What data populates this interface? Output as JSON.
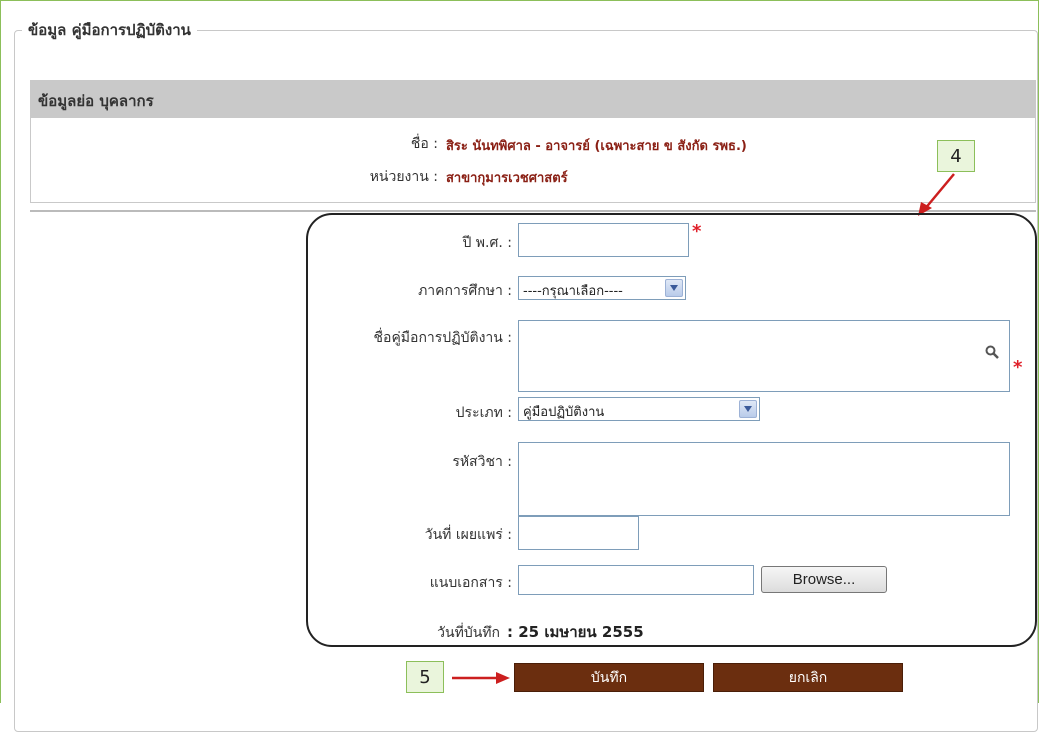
{
  "fieldset": {
    "legend": "ข้อมูล คู่มือการปฏิบัติงาน"
  },
  "personnel": {
    "header": "ข้อมูลย่อ บุคลากร",
    "name_label": "ชื่อ :",
    "name_value": "สิระ นันทพิศาล -  อาจารย์ (เฉพาะสาย ข สังกัด รพธ.)",
    "unit_label": "หน่วยงาน :",
    "unit_value": "สาขากุมารเวชศาสตร์"
  },
  "form": {
    "year_label": "ปี พ.ศ. :",
    "year_value": "",
    "semester_label": "ภาคการศึกษา :",
    "semester_selected": "----กรุณาเลือก----",
    "manual_name_label": "ชื่อคู่มือการปฏิบัติงาน :",
    "manual_name_value": "",
    "type_label": "ประเภท :",
    "type_selected": "คู่มือปฏิบัติงาน",
    "course_code_label": "รหัสวิชา :",
    "course_code_value": "",
    "publish_date_label": "วันที่ เผยแพร่ :",
    "publish_date_value": "",
    "attachment_label": "แนบเอกสาร  :",
    "browse_label": "Browse...",
    "record_date_label": "วันที่บันทึก",
    "record_date_value": ": 25 เมษายน 2555",
    "required_mark": "*"
  },
  "annotations": {
    "step4": "4",
    "step5": "5"
  },
  "actions": {
    "save_label": "บันทึก",
    "cancel_label": "ยกเลิก"
  },
  "colors": {
    "button_bg": "#6b2e0f",
    "required": "#e0202a",
    "value_text": "#8a1f14",
    "annotation_border": "#8cbf5a"
  },
  "icons": {
    "search": "magnifier-icon",
    "arrow": "red-arrow-icon",
    "dropdown": "chevron-down-icon"
  }
}
